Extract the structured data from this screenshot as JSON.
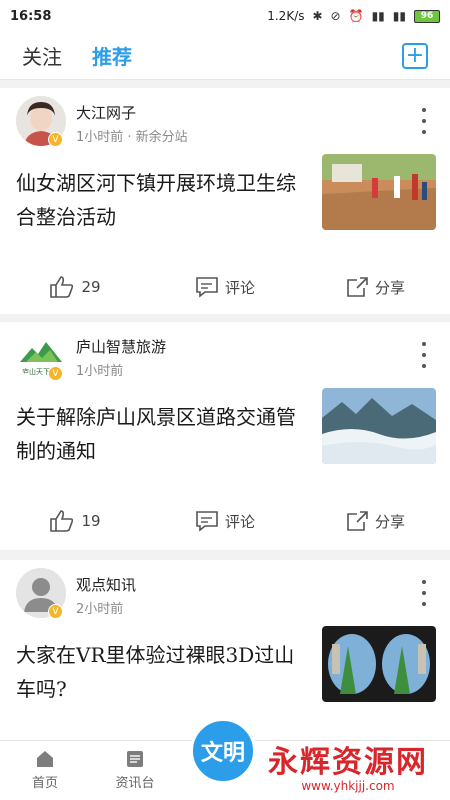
{
  "status": {
    "time": "16:58",
    "speed": "1.2K/s",
    "battery": "96"
  },
  "nav": {
    "tabs": [
      {
        "label": "关注",
        "active": false
      },
      {
        "label": "推荐",
        "active": true
      }
    ]
  },
  "posts": [
    {
      "author": "大江网子",
      "meta": "1小时前 · 新余分站",
      "title": "仙女湖区河下镇开展环境卫生综合整治活动",
      "likes": "29",
      "comment_label": "评论",
      "share_label": "分享"
    },
    {
      "author": "庐山智慧旅游",
      "meta": "1小时前",
      "title": "关于解除庐山风景区道路交通管制的通知",
      "likes": "19",
      "comment_label": "评论",
      "share_label": "分享"
    },
    {
      "author": "观点知讯",
      "meta": "2小时前",
      "title": "大家在VR里体验过裸眼3D过山车吗?"
    }
  ],
  "bottom_nav": {
    "items": [
      {
        "label": "首页",
        "icon": "home-icon"
      },
      {
        "label": "资讯台",
        "icon": "news-icon"
      },
      {
        "label": "文明",
        "icon": "logo-icon"
      }
    ]
  },
  "watermark": {
    "title": "永辉资源网",
    "url": "www.yhkjjj.com"
  },
  "colors": {
    "accent": "#2b9de9",
    "badge": "#f2b62a",
    "watermark": "#d9262b"
  }
}
